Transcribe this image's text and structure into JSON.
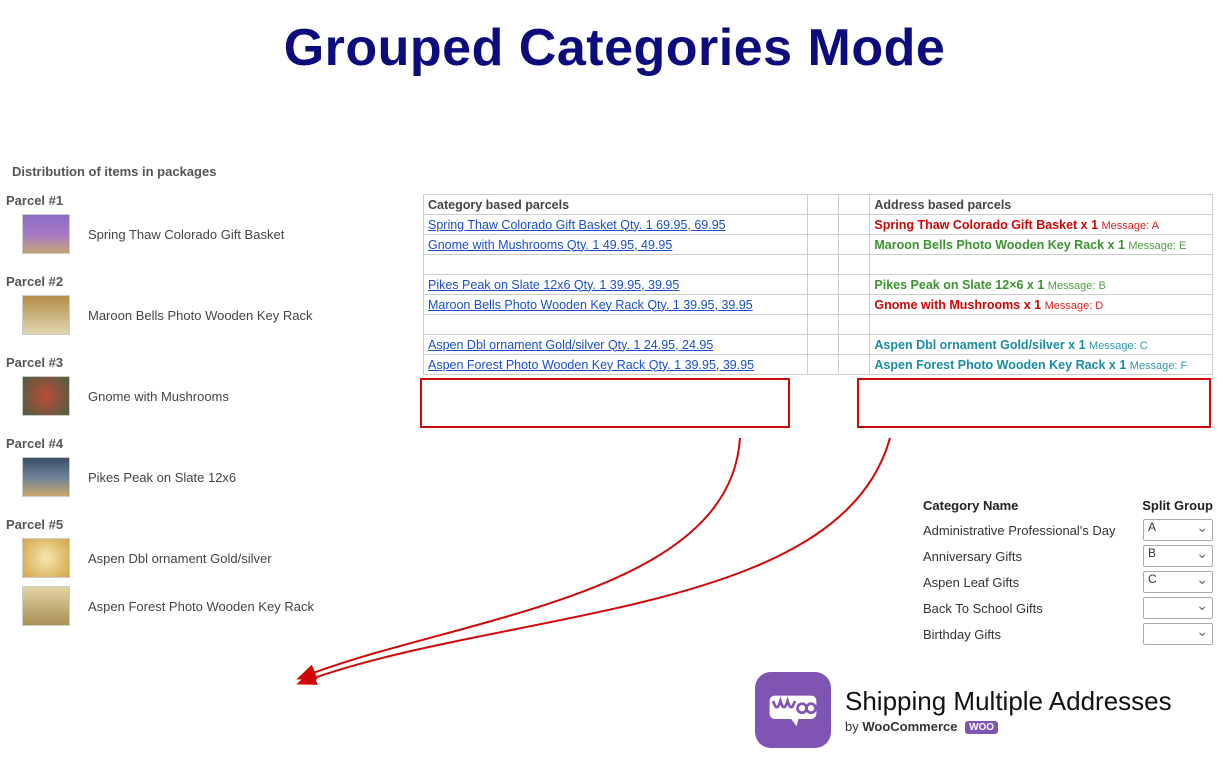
{
  "title": "Grouped Categories Mode",
  "distribution_heading": "Distribution of items in packages",
  "parcels": [
    {
      "label": "Parcel #1",
      "items": [
        {
          "name": "Spring Thaw Colorado Gift Basket",
          "thumb": "basket"
        }
      ]
    },
    {
      "label": "Parcel #2",
      "items": [
        {
          "name": "Maroon Bells Photo Wooden Key Rack",
          "thumb": "key"
        }
      ]
    },
    {
      "label": "Parcel #3",
      "items": [
        {
          "name": "Gnome with Mushrooms",
          "thumb": "gnom"
        }
      ]
    },
    {
      "label": "Parcel #4",
      "items": [
        {
          "name": "Pikes Peak on Slate 12x6",
          "thumb": "slate"
        }
      ]
    },
    {
      "label": "Parcel #5",
      "items": [
        {
          "name": "Aspen Dbl ornament Gold/silver",
          "thumb": "orn"
        },
        {
          "name": "Aspen Forest Photo Wooden Key Rack",
          "thumb": "forest"
        }
      ]
    }
  ],
  "cat_parcels_header": "Category based parcels",
  "addr_parcels_header": "Address based parcels",
  "cat_rows": [
    {
      "text": "Spring Thaw Colorado Gift Basket Qty. 1 69.95, 69.95"
    },
    {
      "text": "Gnome with Mushrooms Qty. 1 49.95, 49.95"
    },
    {
      "blank": true
    },
    {
      "text": "Pikes Peak on Slate 12x6 Qty. 1 39.95, 39.95"
    },
    {
      "text": "Maroon Bells Photo Wooden Key Rack Qty. 1 39.95, 39.95"
    },
    {
      "blank": true
    },
    {
      "text": "Aspen Dbl ornament Gold/silver Qty. 1 24.95, 24.95"
    },
    {
      "text": "Aspen Forest Photo Wooden Key Rack Qty. 1 39.95, 39.95"
    }
  ],
  "addr_rows": [
    {
      "text": "Spring Thaw Colorado Gift Basket x 1",
      "msg": "Message: A",
      "cls": "red"
    },
    {
      "text": "Maroon Bells Photo Wooden Key Rack x 1",
      "msg": "Message: E",
      "cls": "green"
    },
    {
      "blank": true
    },
    {
      "text": "Pikes Peak on Slate 12×6 x 1",
      "msg": "Message: B",
      "cls": "green"
    },
    {
      "text": "Gnome with Mushrooms x 1",
      "msg": "Message: D",
      "cls": "red"
    },
    {
      "blank": true
    },
    {
      "text": "Aspen Dbl ornament Gold/silver x 1",
      "msg": "Message: C",
      "cls": "teal"
    },
    {
      "text": "Aspen Forest Photo Wooden Key Rack x 1",
      "msg": "Message: F",
      "cls": "teal"
    }
  ],
  "cat_table_header": {
    "name": "Category Name",
    "group": "Split Group"
  },
  "cat_table_rows": [
    {
      "name": "Administrative Professional's Day",
      "group": "A"
    },
    {
      "name": "Anniversary Gifts",
      "group": "B"
    },
    {
      "name": "Aspen Leaf Gifts",
      "group": "C"
    },
    {
      "name": "Back To School Gifts",
      "group": ""
    },
    {
      "name": "Birthday Gifts",
      "group": ""
    }
  ],
  "woo": {
    "title": "Shipping Multiple Addresses",
    "by_prefix": "by ",
    "by_brand": "WooCommerce",
    "badge": "WOO"
  }
}
